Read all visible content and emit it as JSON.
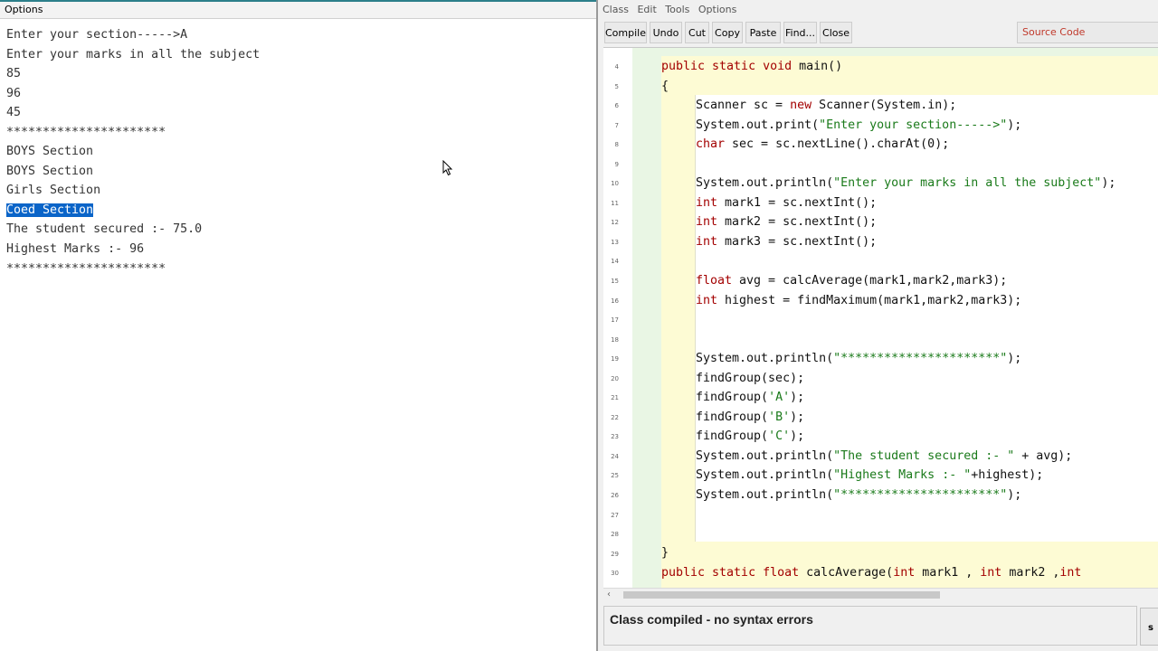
{
  "terminal": {
    "menu": [
      "Options"
    ],
    "output_lines": [
      "Enter your section----->A",
      "Enter your marks in all the subject",
      "85",
      "96",
      "45",
      "**********************",
      "BOYS Section",
      "BOYS Section",
      "Girls Section",
      "Coed Section",
      "The student secured :- 75.0",
      "Highest Marks :- 96",
      "**********************"
    ],
    "selected_line_index": 9
  },
  "editor": {
    "menu": [
      "Class",
      "Edit",
      "Tools",
      "Options"
    ],
    "toolbar": [
      "Compile",
      "Undo",
      "Cut",
      "Copy",
      "Paste",
      "Find...",
      "Close"
    ],
    "view_select": "Source Code",
    "line_numbers": [
      "4",
      "5",
      "6",
      "7",
      "8",
      "9",
      "10",
      "11",
      "12",
      "13",
      "14",
      "15",
      "16",
      "17",
      "18",
      "19",
      "20",
      "21",
      "22",
      "23",
      "24",
      "25",
      "26",
      "27",
      "28",
      "29",
      "30"
    ],
    "code": {
      "l4a": "public static void ",
      "l4b": "main()",
      "l5": "{",
      "l6a": "Scanner sc = ",
      "l6b": "new",
      "l6c": " Scanner(System.in);",
      "l7a": "System.out.print(",
      "l7b": "\"Enter your section----->\"",
      "l7c": ");",
      "l8a": "char",
      "l8b": " sec = sc.nextLine().charAt(0);",
      "l10a": "System.out.println(",
      "l10b": "\"Enter your marks in all the subject\"",
      "l10c": ");",
      "l11a": "int",
      "l11b": " mark1 = sc.nextInt();",
      "l12a": "int",
      "l12b": " mark2 = sc.nextInt();",
      "l13a": "int",
      "l13b": " mark3 = sc.nextInt();",
      "l15a": "float",
      "l15b": " avg = calcAverage(mark1,mark2,mark3);",
      "l16a": "int",
      "l16b": " highest = findMaximum(mark1,mark2,mark3);",
      "l19a": "System.out.println(",
      "l19b": "\"**********************\"",
      "l19c": ");",
      "l20": "findGroup(sec);",
      "l21a": "findGroup(",
      "l21b": "'A'",
      "l21c": ");",
      "l22a": "findGroup(",
      "l22b": "'B'",
      "l22c": ");",
      "l23a": "findGroup(",
      "l23b": "'C'",
      "l23c": ");",
      "l24a": "System.out.println(",
      "l24b": "\"The student secured :- \"",
      "l24c": " + avg);",
      "l25a": "System.out.println(",
      "l25b": "\"Highest Marks :- \"",
      "l25c": "+highest);",
      "l26a": "System.out.println(",
      "l26b": "\"**********************\"",
      "l26c": ");",
      "l29": "}",
      "l30a": "public static float ",
      "l30b": "calcAverage(",
      "l30c": "int",
      "l30d": " mark1 , ",
      "l30e": "int",
      "l30f": " mark2 ,",
      "l30g": "int"
    },
    "status": "Class compiled - no syntax errors",
    "status_side": "s"
  },
  "colors": {
    "keyword": "#a30000",
    "string": "#1a7a1a",
    "selection": "#0a64c8",
    "method_scope": "#fdfbd4",
    "class_scope": "#e9f6e4"
  }
}
